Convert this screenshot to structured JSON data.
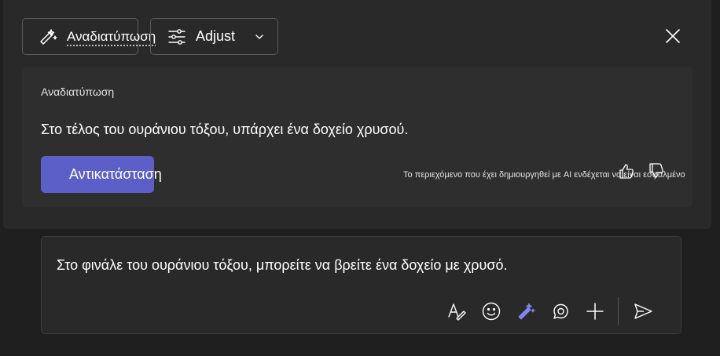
{
  "toolbar": {
    "rewrite_label": "Αναδιατύπωση",
    "adjust_label": "Adjust"
  },
  "card": {
    "title": "Αναδιατύπωση",
    "suggestion": "Στο τέλος του ουράνιου τόξου, υπάρχει ένα δοχείο χρυσού.",
    "replace_label": "Αντικατάσταση",
    "ai_disclaimer": "Το περιεχόμενο που έχει δημιουργηθεί με AI ενδέχεται να είναι εσφαλμένο"
  },
  "compose": {
    "text": "Στο φινάλε του ουράνιου τόξου, μπορείτε να βρείτε ένα δοχείο με χρυσό."
  },
  "icons": {
    "rewrite": "sparkle-pen-icon",
    "adjust": "sliders-icon",
    "chevron": "chevron-down-icon",
    "close": "close-icon",
    "thumbs_up": "thumbs-up-icon",
    "thumbs_down": "thumbs-down-icon",
    "format": "format-text-icon",
    "emoji": "emoji-icon",
    "copilot": "copilot-pen-icon",
    "loop": "loop-icon",
    "add": "plus-icon",
    "send": "send-icon"
  },
  "colors": {
    "accent": "#5b5fc7",
    "copilot_icon": "#7f85f5",
    "background": "#1f1f1f",
    "panel": "#292929"
  }
}
